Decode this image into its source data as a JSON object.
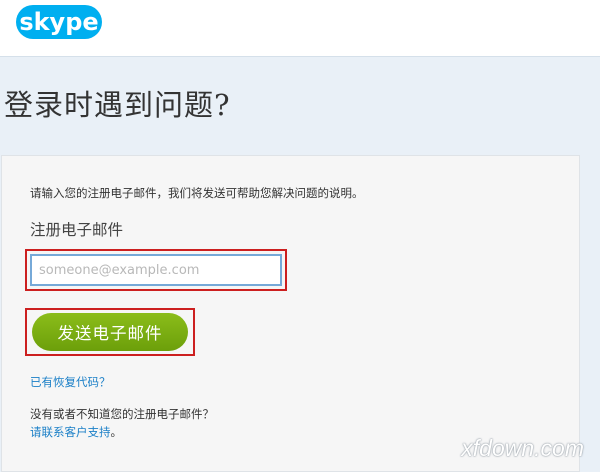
{
  "header": {
    "logo_text": "skype",
    "brand_color": "#00aff0"
  },
  "page": {
    "title": "登录时遇到问题?"
  },
  "form": {
    "instruction": "请输入您的注册电子邮件，我们将发送可帮助您解决问题的说明。",
    "email_label": "注册电子邮件",
    "email_placeholder": "someone@example.com",
    "email_value": "",
    "send_button_label": "发送电子邮件",
    "button_color": "#7aad14",
    "recovery_code_link": "已有恢复代码？",
    "support_question": "没有或者不知道您的注册电子邮件？",
    "support_link": "请联系客户支持",
    "support_suffix": "。"
  },
  "watermark": "xfdown.com"
}
